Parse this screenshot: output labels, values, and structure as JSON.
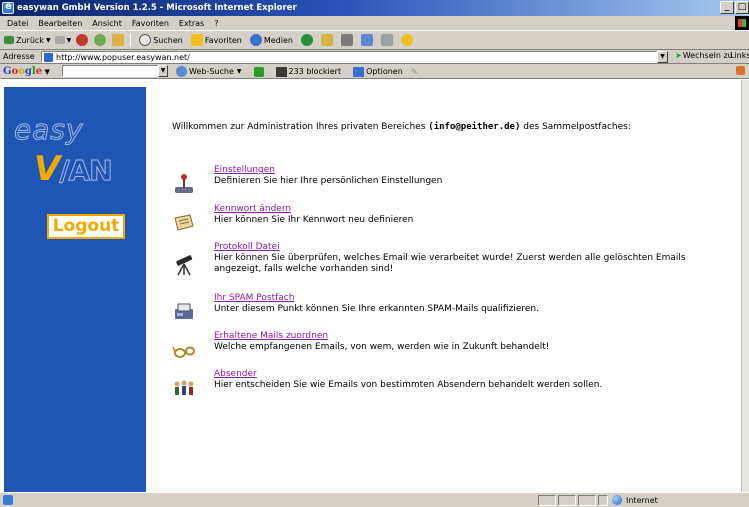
{
  "window": {
    "title": "easywan GmbH Version 1.2.5 - Microsoft Internet Explorer",
    "controls": [
      "_",
      "□"
    ]
  },
  "menu": [
    "Datei",
    "Bearbeiten",
    "Ansicht",
    "Favoriten",
    "Extras",
    "?"
  ],
  "toolbar": {
    "back": "Zurück",
    "search": "Suchen",
    "favorites": "Favoriten",
    "media": "Medien"
  },
  "address": {
    "label": "Adresse",
    "url": "http://www.popuser.easywan.net/",
    "go": "Wechseln zu",
    "links": "Links"
  },
  "google": {
    "web_search": "Web-Suche",
    "blocked": "233 blockiert",
    "options": "Optionen"
  },
  "sidebar": {
    "logout": "Logout"
  },
  "content": {
    "welcome_before": "Willkommen zur Administration Ihres privaten Bereiches ",
    "welcome_email": "(info@peither.de)",
    "welcome_after": " des Sammelpostfaches:",
    "entries": [
      {
        "link": "Einstellungen",
        "desc": "Definieren Sie hier Ihre persönlichen Einstellungen",
        "icon": "joystick-icon"
      },
      {
        "link": "Kennwort ändern",
        "desc": "Hier können Sie Ihr Kennwort neu definieren",
        "icon": "scroll-icon"
      },
      {
        "link": "Protokoll Datei",
        "desc": "Hier können Sie überprüfen, welches Email wie verarbeitet wurde! Zuerst werden alle gelöschten Emails angezeigt, falls welche vorhanden sind!",
        "icon": "telescope-icon"
      },
      {
        "link": "Ihr SPAM Postfach",
        "desc": "Unter diesem Punkt können Sie Ihre erkannten SPAM-Mails qualifizieren.",
        "icon": "fax-icon"
      },
      {
        "link": "Erhaltene Mails zuordnen",
        "desc": "Welche empfangenen Emails, von wem, werden wie in Zukunft behandelt!",
        "icon": "glasses-icon"
      },
      {
        "link": "Absender",
        "desc": "Hier entscheiden Sie wie Emails von bestimmten Absendern behandelt werden sollen.",
        "icon": "people-icon"
      }
    ]
  },
  "status": {
    "zone": "Internet"
  }
}
